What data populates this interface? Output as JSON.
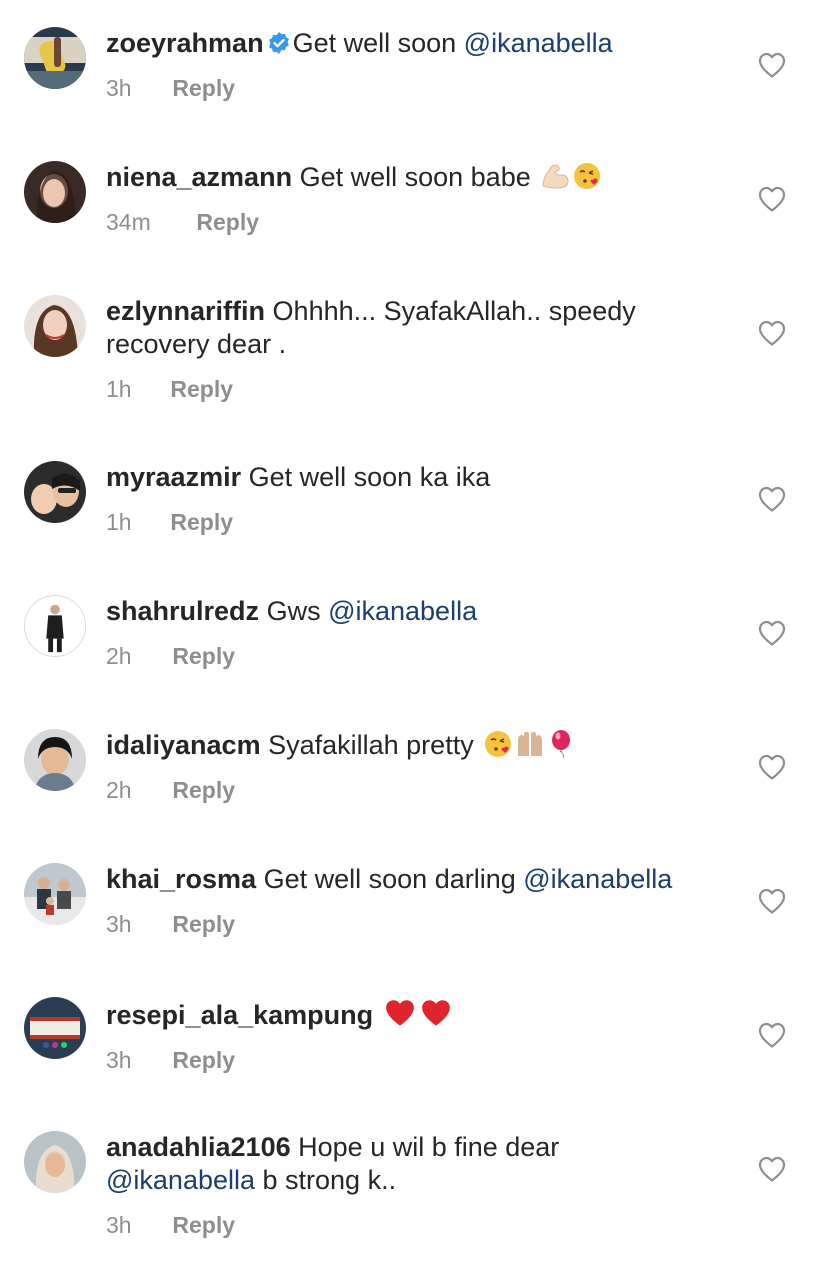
{
  "comments": [
    {
      "username": "zoeyrahman",
      "verified": true,
      "text": "Get well soon ",
      "mention": "@ikanabella",
      "text_after": "",
      "time": "3h",
      "reply": "Reply"
    },
    {
      "username": "niena_azmann",
      "text": "Get well soon babe ",
      "emoji": [
        "flexed-biceps-light",
        "face-blowing-kiss"
      ],
      "time": "34m",
      "reply": "Reply"
    },
    {
      "username": "ezlynnariffin",
      "text": "Ohhhh... SyafakAllah.. speedy recovery dear .",
      "time": "1h",
      "reply": "Reply"
    },
    {
      "username": "myraazmir",
      "text": "Get well soon ka ika",
      "time": "1h",
      "reply": "Reply"
    },
    {
      "username": "shahrulredz",
      "text": "Gws ",
      "mention": "@ikanabella",
      "time": "2h",
      "reply": "Reply"
    },
    {
      "username": "idaliyanacm",
      "text": "Syafakillah pretty ",
      "emoji": [
        "face-blowing-kiss",
        "raising-hands-medium-light",
        "balloon"
      ],
      "time": "2h",
      "reply": "Reply"
    },
    {
      "username": "khai_rosma",
      "text": "Get well soon darling ",
      "mention": "@ikanabella",
      "time": "3h",
      "reply": "Reply"
    },
    {
      "username": "resepi_ala_kampung",
      "text": "",
      "emoji": [
        "red-heart",
        "red-heart"
      ],
      "time": "3h",
      "reply": "Reply"
    },
    {
      "username": "anadahlia2106",
      "text": "Hope u wil b fine dear ",
      "mention": "@ikanabella",
      "text_after": " b strong k..",
      "time": "3h",
      "reply": "Reply"
    }
  ],
  "icons": {
    "like": "heart-outline-icon",
    "verified": "verified-badge-icon"
  },
  "colors": {
    "mention": "#1c3d6e",
    "meta": "#8e8e8e",
    "verified": "#3897f0"
  }
}
